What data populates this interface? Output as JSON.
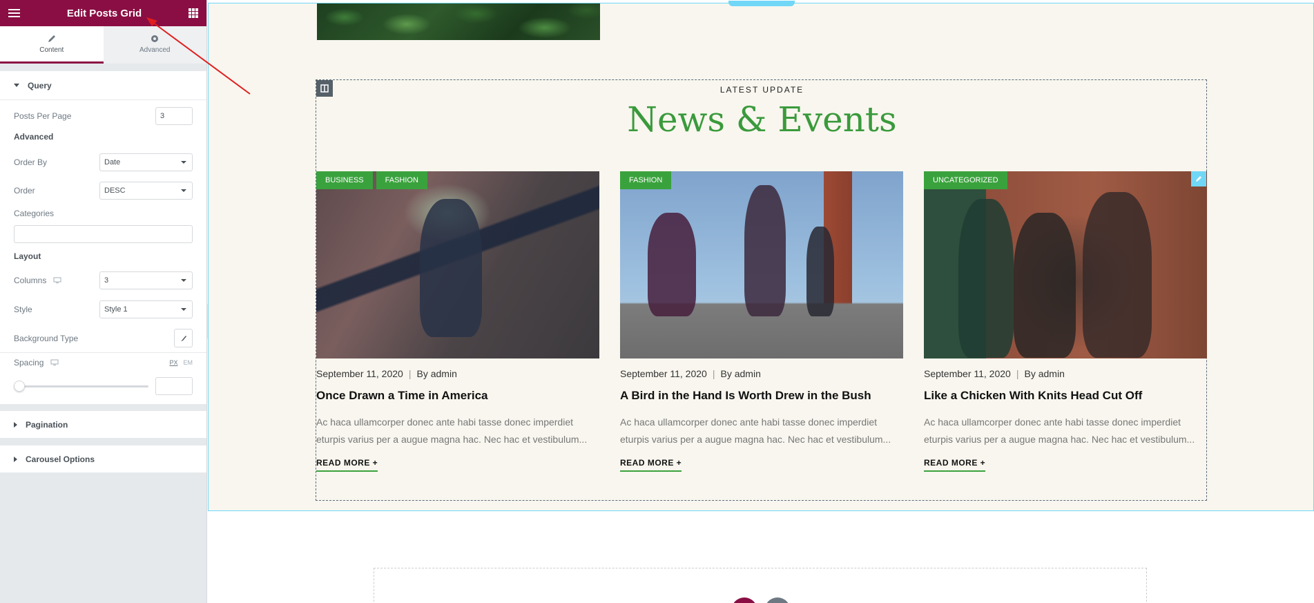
{
  "panel": {
    "title": "Edit Posts Grid",
    "tabs": [
      {
        "label": "Content",
        "icon": "pencil-icon"
      },
      {
        "label": "Advanced",
        "icon": "gear-icon"
      }
    ],
    "query": {
      "section_label": "Query",
      "posts_per_page_label": "Posts Per Page",
      "posts_per_page_value": "3",
      "advanced_label": "Advanced",
      "order_by_label": "Order By",
      "order_by_value": "Date",
      "order_label": "Order",
      "order_value": "DESC",
      "categories_label": "Categories",
      "layout_label": "Layout",
      "columns_label": "Columns",
      "columns_value": "3",
      "style_label": "Style",
      "style_value": "Style 1",
      "background_type_label": "Background Type",
      "spacing_label": "Spacing",
      "unit_px": "PX",
      "unit_em": "EM",
      "spacing_value": ""
    },
    "pagination_label": "Pagination",
    "carousel_label": "Carousel Options"
  },
  "preview": {
    "subtitle": "LATEST UPDATE",
    "heading": "News & Events",
    "posts": [
      {
        "categories": [
          "BUSINESS",
          "FASHION"
        ],
        "date": "September 11, 2020",
        "separator": "|",
        "by": "By",
        "author": "admin",
        "title": "Once Drawn a Time in America",
        "excerpt": "Ac haca ullamcorper donec ante habi tasse donec imperdiet eturpis varius per a augue magna hac. Nec hac et vestibulum...",
        "read_more": "READ MORE +"
      },
      {
        "categories": [
          "FASHION"
        ],
        "date": "September 11, 2020",
        "separator": "|",
        "by": "By",
        "author": "admin",
        "title": "A Bird in the Hand Is Worth Drew in the Bush",
        "excerpt": "Ac haca ullamcorper donec ante habi tasse donec imperdiet eturpis varius per a augue magna hac. Nec hac et vestibulum...",
        "read_more": "READ MORE +"
      },
      {
        "categories": [
          "UNCATEGORIZED"
        ],
        "date": "September 11, 2020",
        "separator": "|",
        "by": "By",
        "author": "admin",
        "title": "Like a Chicken With Knits Head Cut Off",
        "excerpt": "Ac haca ullamcorper donec ante habi tasse donec imperdiet eturpis varius per a augue magna hac. Nec hac et vestibulum...",
        "read_more": "READ MORE +"
      }
    ]
  },
  "colors": {
    "panel_header": "#8a0e43",
    "accent_green": "#3aa23d",
    "heading_green": "#3a9a3c",
    "canvas_bg": "#f8f6ee",
    "selection_blue": "#71d7f7"
  }
}
